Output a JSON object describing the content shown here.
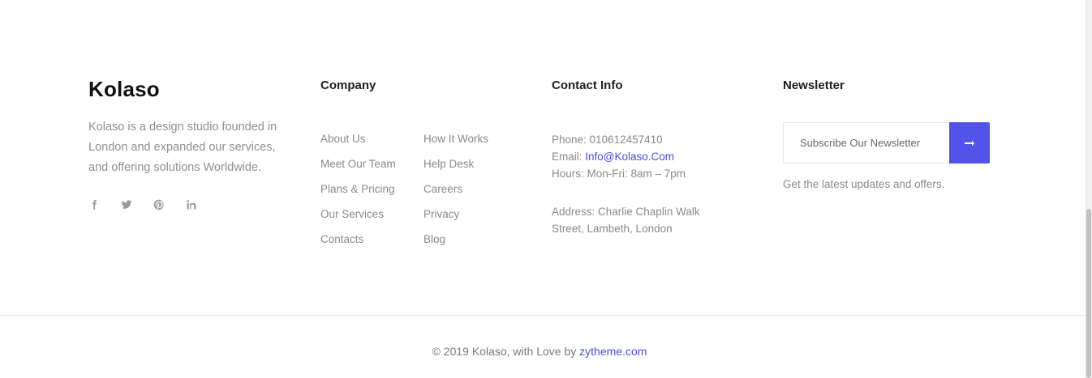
{
  "brand": {
    "logo": "Kolaso",
    "description": "Kolaso is a design studio founded in London and expanded our services, and offering solutions Worldwide.",
    "social": [
      "facebook-icon",
      "twitter-icon",
      "pinterest-icon",
      "linkedin-icon"
    ]
  },
  "company": {
    "title": "Company",
    "links_left": [
      "About Us",
      "Meet Our Team",
      "Plans & Pricing",
      "Our Services",
      "Contacts"
    ],
    "links_right": [
      "How It Works",
      "Help Desk",
      "Careers",
      "Privacy",
      "Blog"
    ]
  },
  "contact": {
    "title": "Contact Info",
    "phone": "Phone: 010612457410",
    "email_label": "Email: ",
    "email": "Info@Kolaso.Com",
    "hours": "Hours: Mon-Fri: 8am – 7pm",
    "address": "Address: Charlie Chaplin Walk Street, Lambeth, London"
  },
  "newsletter": {
    "title": "Newsletter",
    "placeholder": "Subscribe Our Newsletter",
    "note": "Get the latest updates and offers."
  },
  "footer": {
    "copyright_prefix": "© 2019 Kolaso, with Love by ",
    "link": "zytheme.com"
  },
  "colors": {
    "accent": "#5353e9",
    "link": "#4b4fd6"
  }
}
